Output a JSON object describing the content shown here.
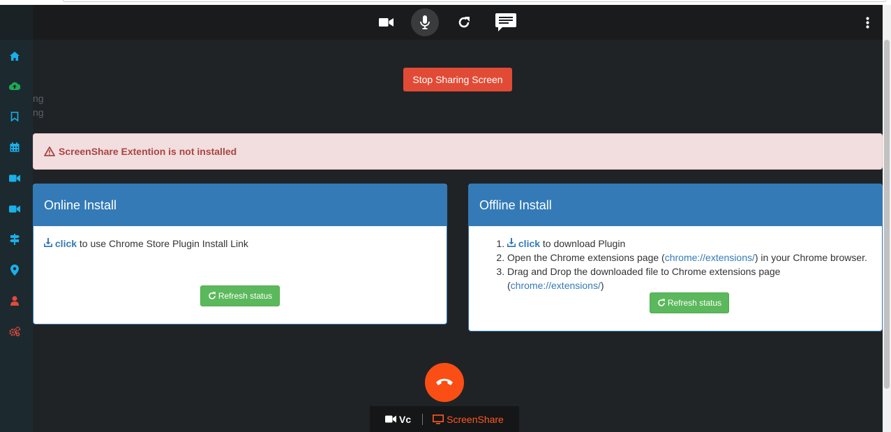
{
  "topbar": {
    "icons": [
      "video-camera-icon",
      "microphone-icon",
      "refresh-icon",
      "chat-icon",
      "more-vertical-icon"
    ]
  },
  "sidebar": {
    "icons": [
      "home-icon",
      "cloud-upload-icon",
      "bookmark-icon",
      "calendar-icon",
      "video-camera-icon",
      "video-camera-icon",
      "signpost-icon",
      "map-marker-icon",
      "user-icon",
      "cogs-icon"
    ],
    "ghost_texts": [
      "ng",
      "ng"
    ]
  },
  "screen_share": {
    "stop_label": "Stop Sharing Screen"
  },
  "alert": {
    "message": "ScreenShare Extention is not installed"
  },
  "online_install": {
    "title": "Online Install",
    "link_label": "click",
    "text": " to use Chrome Store Plugin Install Link",
    "refresh_label": "Refresh status"
  },
  "offline_install": {
    "title": "Offline Install",
    "step1_link": "click",
    "step1_text": " to download Plugin",
    "step2_before": "Open the Chrome extensions page (",
    "step2_link": "chrome://extensions/",
    "step2_after": ") in your Chrome browser.",
    "step3_text": "Drag and Drop the downloaded file to Chrome extensions page (",
    "step3_link": "chrome://extensions/",
    "step3_after": ")",
    "refresh_label": "Refresh status"
  },
  "bottom_tabs": {
    "vc_label": "Vc",
    "screenshare_label": "ScreenShare"
  },
  "colors": {
    "primary": "#337ab7",
    "danger": "#e14b36",
    "success": "#5cb85c",
    "hangup": "#fb4e14",
    "sidebar_icon": "#1ab0e8"
  }
}
